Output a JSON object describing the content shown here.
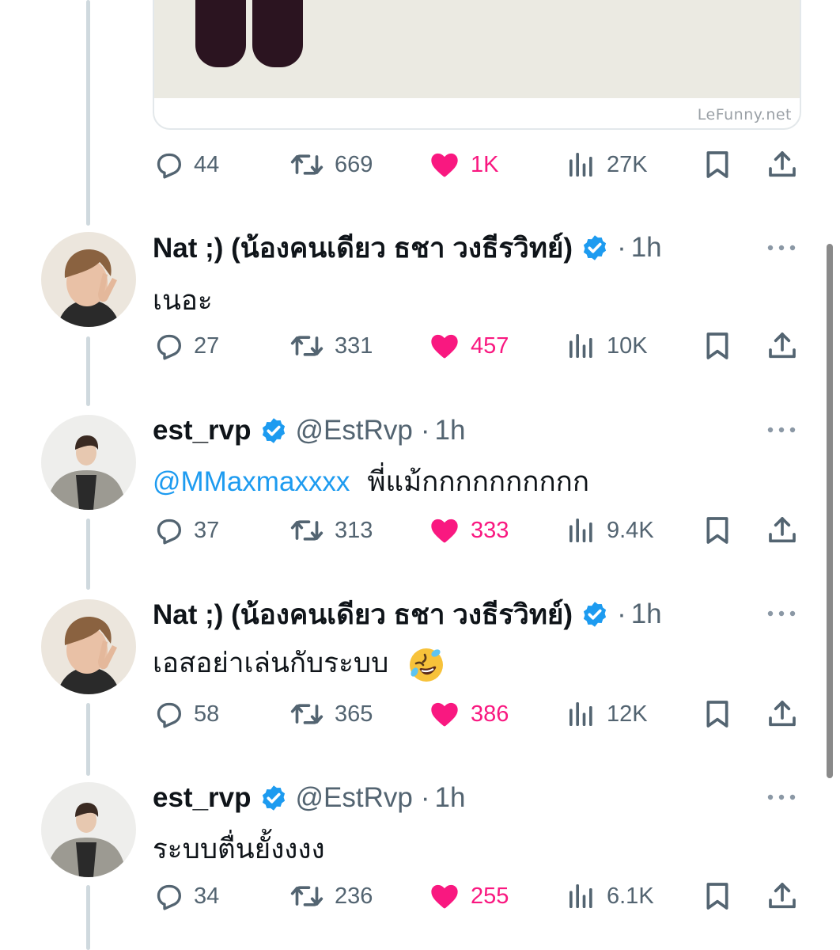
{
  "media": {
    "watermark": "LeFunny.net"
  },
  "top_actions": {
    "replies": "44",
    "retweets": "669",
    "likes": "1K",
    "views": "27K"
  },
  "tweets": [
    {
      "display_name": "Nat ;) (น้องคนเดียว ธชา วงธีรวิทย์)",
      "handle": "",
      "dot": "·",
      "time": "1h",
      "mention": "",
      "text": "เนอะ",
      "replies": "27",
      "retweets": "331",
      "likes": "457",
      "views": "10K"
    },
    {
      "display_name": "est_rvp",
      "handle": "@EstRvp",
      "dot": "·",
      "time": "1h",
      "mention": "@MMaxmaxxxx",
      "text": "พี่แม้กกกกกกกกกก",
      "replies": "37",
      "retweets": "313",
      "likes": "333",
      "views": "9.4K"
    },
    {
      "display_name": "Nat ;) (น้องคนเดียว ธชา วงธีรวิทย์)",
      "handle": "",
      "dot": "·",
      "time": "1h",
      "mention": "",
      "text": "เอสอย่าเล่นกับระบบ",
      "emoji": "rolling-on-floor-laughing",
      "replies": "58",
      "retweets": "365",
      "likes": "386",
      "views": "12K"
    },
    {
      "display_name": "est_rvp",
      "handle": "@EstRvp",
      "dot": "·",
      "time": "1h",
      "mention": "",
      "text": "ระบบตื่นยั้งงงง",
      "replies": "34",
      "retweets": "236",
      "likes": "255",
      "views": "6.1K"
    }
  ],
  "colors": {
    "text": "#0f1419",
    "secondary": "#536471",
    "like_active": "#f91880",
    "link": "#1d9bf0",
    "verified": "#1d9bf0",
    "thread_line": "#cfd9de"
  }
}
